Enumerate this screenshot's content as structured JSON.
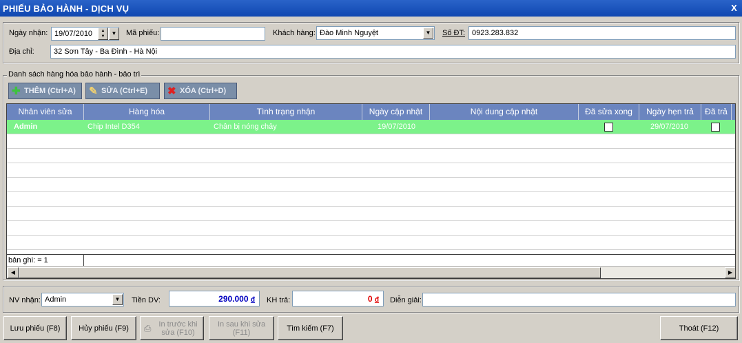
{
  "window": {
    "title": "PHIẾU BẢO HÀNH - DỊCH VỤ",
    "close_label": "X"
  },
  "header": {
    "ngay_nhan_label": "Ngày nhận:",
    "ngay_nhan_value": "19/07/2010",
    "ma_phieu_label": "Mã phiếu:",
    "ma_phieu_value": "",
    "khach_hang_label": "Khách hàng:",
    "khach_hang_value": "Đào Minh Nguyệt",
    "so_dt_label": "Số ĐT:",
    "so_dt_value": "0923.283.832",
    "dia_chi_label": "Địa chỉ:",
    "dia_chi_value": "32 Sơn Tây - Ba Đình - Hà Nội"
  },
  "group": {
    "title": "Danh sách hàng hóa bảo hành - bảo trì",
    "toolbar": {
      "add_label": "THÊM (Ctrl+A)",
      "edit_label": "SỬA (Ctrl+E)",
      "delete_label": "XÓA (Ctrl+D)"
    },
    "columns": [
      "Nhân viên sửa",
      "Hàng hóa",
      "Tình trạng nhận",
      "Ngày cập nhật",
      "Nội dung cập nhật",
      "Đã sửa xong",
      "Ngày hẹn trả",
      "Đã trả"
    ],
    "rows": [
      {
        "nhan_vien": "Admin",
        "hang_hoa": "Chip Intel D354",
        "tinh_trang": "Chân bị nóng chảy",
        "ngay_cap_nhat": "19/07/2010",
        "noi_dung": "",
        "da_sua_xong": false,
        "ngay_hen_tra": "29/07/2010",
        "da_tra": false
      }
    ],
    "record_count": "bản ghi: = 1"
  },
  "footer": {
    "nv_nhan_label": "NV nhận:",
    "nv_nhan_value": "Admin",
    "tien_dv_label": "Tiền DV:",
    "tien_dv_value": "290.000",
    "kh_tra_label": "KH trả:",
    "kh_tra_value": "0",
    "currency": "đ",
    "dien_giai_label": "Diễn giải:",
    "dien_giai_value": ""
  },
  "buttons": {
    "luu": "Lưu phiếu (F8)",
    "huy": "Hủy phiếu (F9)",
    "in_truoc_1": "In trước khi",
    "in_truoc_2": "sửa (F10)",
    "in_sau_1": "In sau khi sửa",
    "in_sau_2": "(F11)",
    "tim_kiem": "Tìm kiếm (F7)",
    "thoat": "Thoát (F12)"
  },
  "colors": {
    "titlebar": "#0f47b0",
    "grid_header": "#6b85bf",
    "selected_row": "#7cf28a",
    "tien_dv": "#0000c0",
    "kh_tra": "#e00000",
    "toolbar_button": "#7a8ea8"
  }
}
